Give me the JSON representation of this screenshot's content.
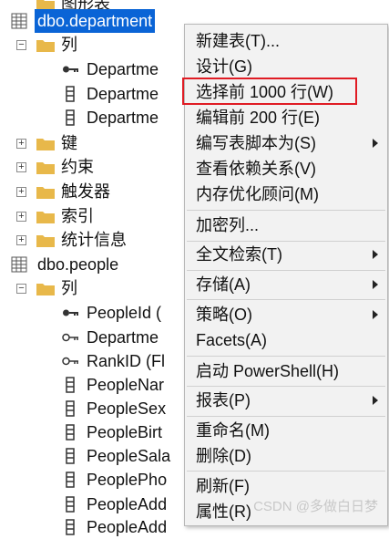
{
  "tree": {
    "rows": [
      {
        "label": "图形表"
      },
      {
        "label": "dbo.department"
      },
      {
        "label": "列"
      },
      {
        "label": "Departme"
      },
      {
        "label": "Departme"
      },
      {
        "label": "Departme"
      },
      {
        "label": "键"
      },
      {
        "label": "约束"
      },
      {
        "label": "触发器"
      },
      {
        "label": "索引"
      },
      {
        "label": "统计信息"
      },
      {
        "label": "dbo.people"
      },
      {
        "label": "列"
      },
      {
        "label": "PeopleId ("
      },
      {
        "label": "Departme"
      },
      {
        "label": "RankID (Fl"
      },
      {
        "label": "PeopleNar"
      },
      {
        "label": "PeopleSex"
      },
      {
        "label": "PeopleBirt"
      },
      {
        "label": "PeopleSala"
      },
      {
        "label": "PeoplePho"
      },
      {
        "label": "PeopleAdd"
      },
      {
        "label": "PeopleAdd"
      }
    ]
  },
  "context_menu": {
    "items": [
      {
        "label": "新建表(T)..."
      },
      {
        "label": "设计(G)"
      },
      {
        "label": "选择前 1000 行(W)"
      },
      {
        "label": "编辑前 200 行(E)"
      },
      {
        "label": "编写表脚本为(S)"
      },
      {
        "label": "查看依赖关系(V)"
      },
      {
        "label": "内存优化顾问(M)"
      },
      {
        "label": "加密列..."
      },
      {
        "label": "全文检索(T)"
      },
      {
        "label": "存储(A)"
      },
      {
        "label": "策略(O)"
      },
      {
        "label": "Facets(A)"
      },
      {
        "label": "启动 PowerShell(H)"
      },
      {
        "label": "报表(P)"
      },
      {
        "label": "重命名(M)"
      },
      {
        "label": "删除(D)"
      },
      {
        "label": "刷新(F)"
      },
      {
        "label": "属性(R)"
      }
    ]
  },
  "watermark": "CSDN @多做白日梦",
  "colors": {
    "selection": "#0a64d6",
    "highlight_box": "#e01c24",
    "folder": "#e8b84a"
  }
}
